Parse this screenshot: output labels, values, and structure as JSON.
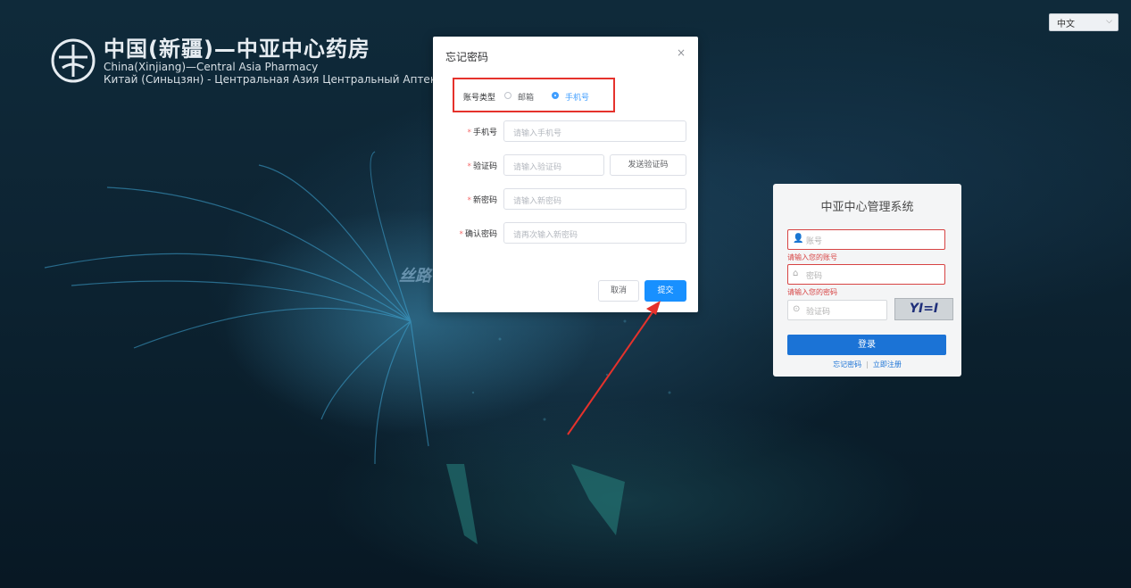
{
  "header": {
    "logo_title": "中国(新疆)—中亚中心药房",
    "logo_subtitle_en": "China(Xinjiang)—Central Asia Pharmacy",
    "logo_subtitle_ru": "Китай (Синьцзян) - Центральная Азия Центральный Аптека",
    "language": "中文"
  },
  "map_label": "丝路",
  "login": {
    "title": "中亚中心管理系统",
    "account_placeholder": "账号",
    "account_error": "请输入您的账号",
    "password_placeholder": "密码",
    "password_error": "请输入您的密码",
    "captcha_placeholder": "验证码",
    "captcha_text": "YI=I",
    "login_button": "登录",
    "forgot_link": "忘记密码",
    "register_link": "立即注册"
  },
  "dialog": {
    "title": "忘记密码",
    "close": "×",
    "account_type_label": "账号类型",
    "option_email": "邮箱",
    "option_phone": "手机号",
    "selected_option": "手机号",
    "fields": {
      "phone_label": "手机号",
      "phone_placeholder": "请输入手机号",
      "code_label": "验证码",
      "code_placeholder": "请输入验证码",
      "send_code_button": "发送验证码",
      "new_password_label": "新密码",
      "new_password_placeholder": "请输入新密码",
      "confirm_password_label": "确认密码",
      "confirm_password_placeholder": "请再次输入新密码"
    },
    "cancel_button": "取消",
    "submit_button": "提交"
  },
  "colors": {
    "primary": "#1890ff",
    "error": "#d74343",
    "highlight": "#e5322c"
  }
}
